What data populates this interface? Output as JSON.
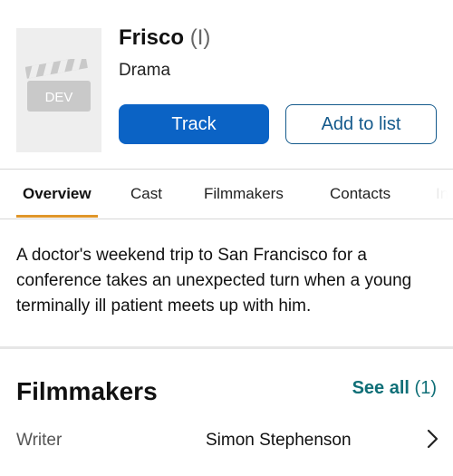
{
  "movie": {
    "title": "Frisco",
    "title_suffix": "(I)",
    "genre": "Drama",
    "poster_badge": "DEV",
    "description": "A doctor's weekend trip to San Francisco for a conference takes an unexpected turn when a young terminally ill patient meets up with him."
  },
  "actions": {
    "track_label": "Track",
    "add_to_list_label": "Add to list"
  },
  "tabs": [
    {
      "label": "Overview",
      "active": true
    },
    {
      "label": "Cast",
      "active": false
    },
    {
      "label": "Filmmakers",
      "active": false
    },
    {
      "label": "Contacts",
      "active": false
    },
    {
      "label": "In",
      "active": false
    }
  ],
  "filmmakers": {
    "heading": "Filmmakers",
    "see_all_label": "See all",
    "see_all_count": "(1)",
    "rows": [
      {
        "role": "Writer",
        "name": "Simon Stephenson"
      }
    ]
  },
  "colors": {
    "primary": "#0b63c5",
    "accent_underline": "#e0962a",
    "link": "#0f6f77"
  },
  "icons": {
    "poster": "clapperboard-icon",
    "row_arrow": "chevron-right-icon"
  }
}
